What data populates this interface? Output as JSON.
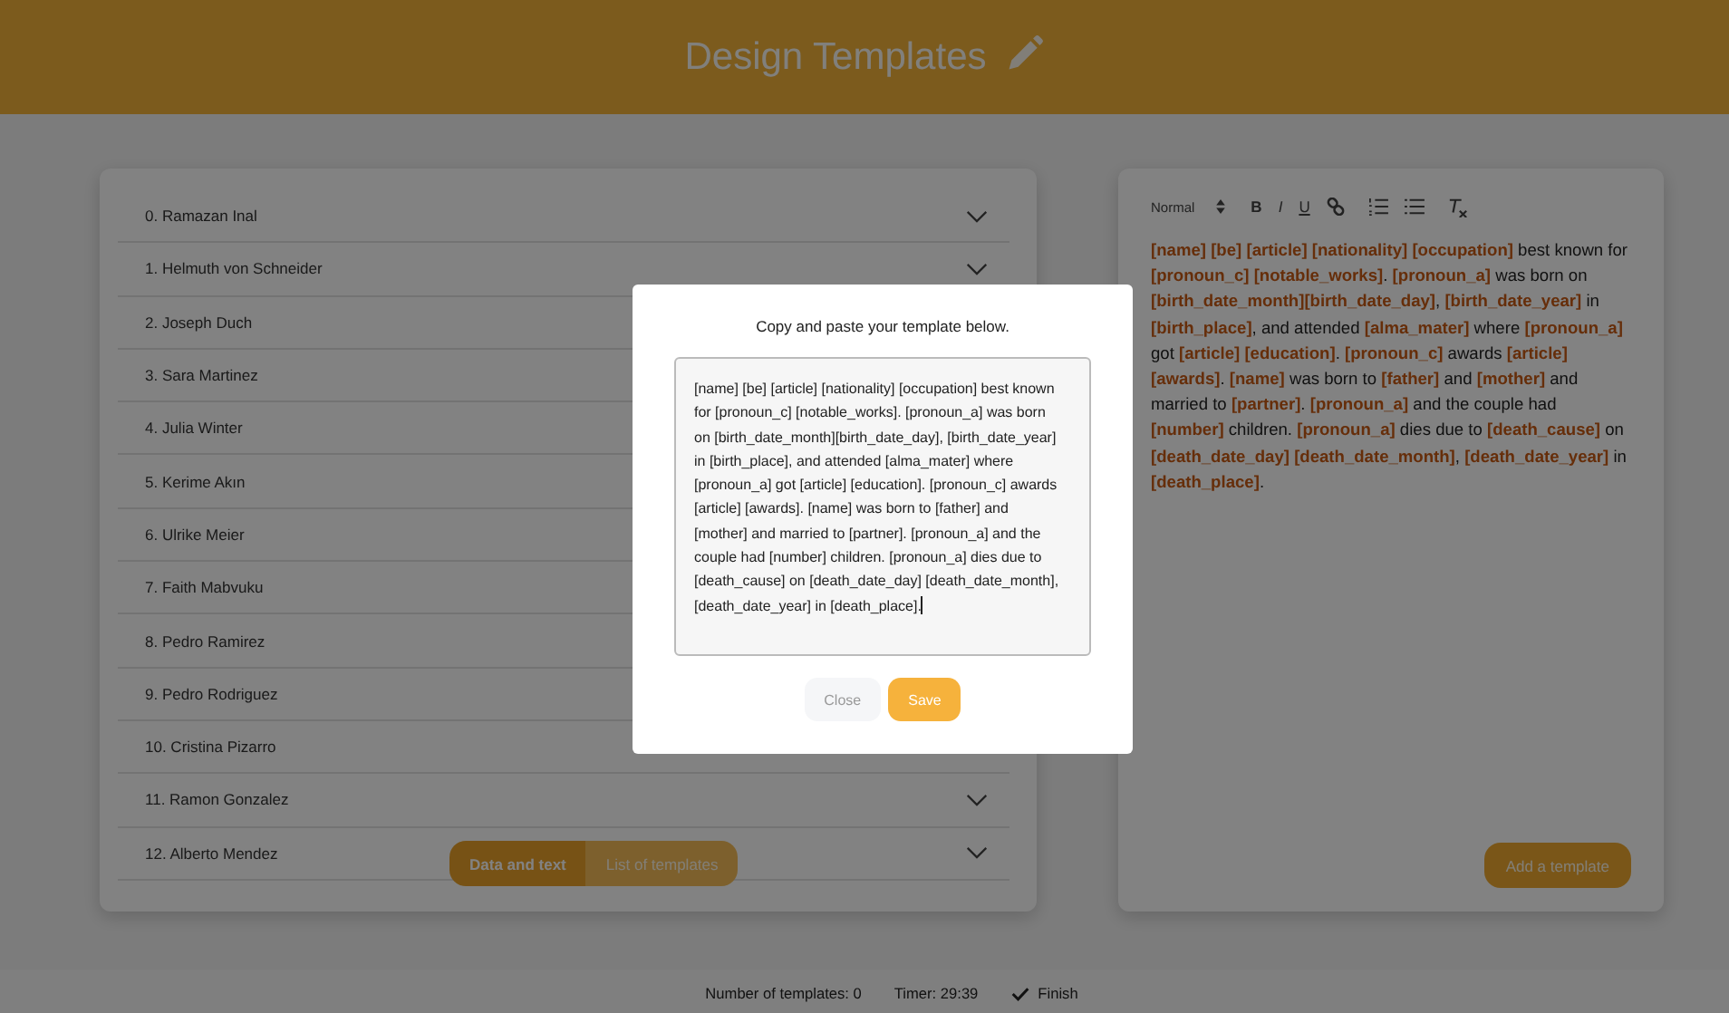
{
  "header": {
    "title": "Design Templates"
  },
  "people": [
    {
      "label": "0. Ramazan Inal",
      "chevron": true
    },
    {
      "label": "1. Helmuth von Schneider",
      "chevron": true
    },
    {
      "label": "2. Joseph Duch",
      "chevron": false
    },
    {
      "label": "3. Sara Martinez",
      "chevron": false
    },
    {
      "label": "4. Julia Winter",
      "chevron": false
    },
    {
      "label": "5. Kerime Akın",
      "chevron": false
    },
    {
      "label": "6. Ulrike Meier",
      "chevron": false
    },
    {
      "label": "7. Faith Mabvuku",
      "chevron": false
    },
    {
      "label": "8. Pedro Ramirez",
      "chevron": false
    },
    {
      "label": "9. Pedro Rodriguez",
      "chevron": false
    },
    {
      "label": "10. Cristina Pizarro",
      "chevron": false
    },
    {
      "label": "11. Ramon Gonzalez",
      "chevron": true
    },
    {
      "label": "12. Alberto Mendez",
      "chevron": true
    }
  ],
  "view_tabs": [
    {
      "label": "Data and text",
      "selected": true
    },
    {
      "label": "List of templates",
      "selected": false
    }
  ],
  "editor": {
    "format": "Normal",
    "tools": [
      {
        "kind": "bold",
        "label": "B"
      },
      {
        "kind": "italic",
        "label": "I"
      },
      {
        "kind": "underline",
        "label": "U"
      },
      {
        "kind": "link"
      },
      {
        "kind": "ordered_list"
      },
      {
        "kind": "bullet_list"
      },
      {
        "kind": "clear"
      }
    ],
    "text": "**[name]** **[be]** **[article]** **[nationality]** **[occupation]** best known for **[pronoun_c]** **[notable_works]**. **[pronoun_a]** was born on **[birth_date_month][birth_date_day]**, **[birth_date_year]** in **[birth_place]**, and attended **[alma_mater]** where **[pronoun_a]** got **[article]** **[education]**. **[pronoun_c]** awards **[article]** **[awards]**. **[name]** was born to **[father]** and **[mother]** and married to **[partner]**. **[pronoun_a]** and the couple had **[number]** children. **[pronoun_a]** dies due to **[death_cause]** on **[death_date_day]** **[death_date_month]**, **[death_date_year]** in **[death_place]**.",
    "add_button": "Add a template"
  },
  "modal": {
    "prompt": "Copy and paste your template below.",
    "template": "[name] [be] [article] [nationality] [occupation] best known for [pronoun_c] [notable_works]. [pronoun_a] was born on [birth_date_month][birth_date_day], [birth_date_year] in [birth_place], and attended [alma_mater] where [pronoun_a] got [article] [education]. [pronoun_c] awards [article] [awards]. [name] was born to [father] and [mother] and married to [partner]. [pronoun_a] and the couple had [number] children. [pronoun_a] dies due to [death_cause] on [death_date_day] [death_date_month], [death_date_year] in [death_place].",
    "buttons": [
      {
        "label": "Close",
        "kind": "secondary"
      },
      {
        "label": "Save",
        "kind": "primary"
      }
    ]
  },
  "status_bar": {
    "count": "Number of templates: 0",
    "timer": "Timer: 29:39",
    "finish": "Finish"
  }
}
